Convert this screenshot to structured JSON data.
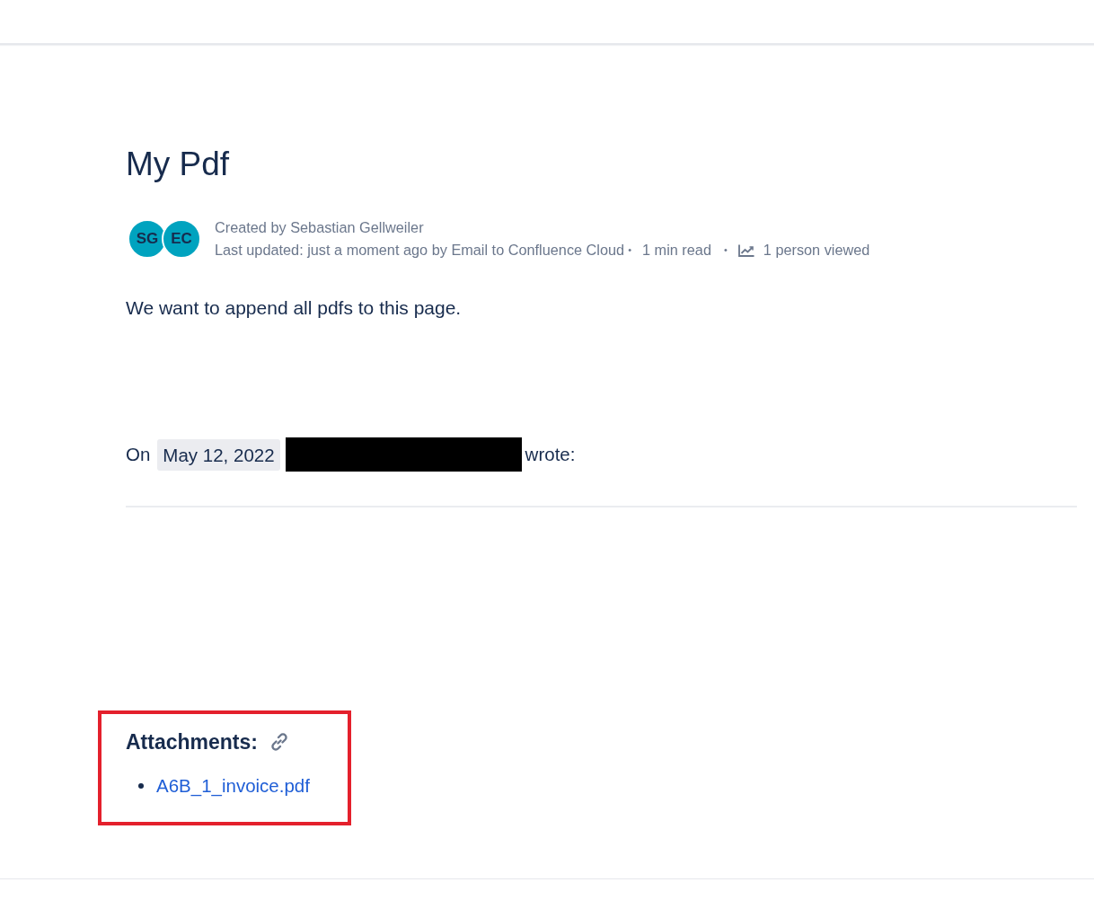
{
  "title": "My Pdf",
  "byline": {
    "avatars": [
      {
        "initials": "SG"
      },
      {
        "initials": "EC"
      }
    ],
    "created": "Created by Sebastian Gellweiler",
    "updated": "Last updated: just a moment ago by Email to Confluence Cloud",
    "separator_1": "•",
    "read_time": "1 min read",
    "separator_2": "•",
    "views": "1 person viewed"
  },
  "body": {
    "paragraph": "We want to append all pdfs to this page.",
    "quote_line": {
      "prefix": "On",
      "date": "May 12, 2022",
      "redacted": true,
      "suffix": "wrote:"
    }
  },
  "attachments": {
    "highlighted": true,
    "heading": "Attachments:",
    "files": [
      "A6B_1_invoice.pdf"
    ]
  }
}
